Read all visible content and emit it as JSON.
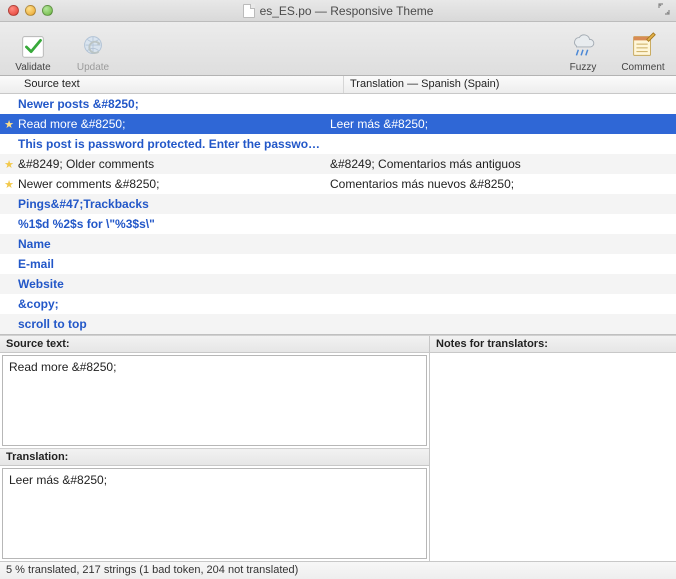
{
  "window": {
    "title": "es_ES.po — Responsive Theme"
  },
  "toolbar": {
    "validate": "Validate",
    "update": "Update",
    "fuzzy": "Fuzzy",
    "comment": "Comment"
  },
  "columns": {
    "source_text": "Source text",
    "translation": "Translation — Spanish (Spain)"
  },
  "rows": [
    {
      "star": "",
      "src": "Newer posts &#8250;",
      "tr": "",
      "style": "blue"
    },
    {
      "star": "★",
      "src": "Read more &#8250;",
      "tr": "Leer más &#8250;",
      "style": "sel"
    },
    {
      "star": "",
      "src": "This post is password protected. Enter the passwo…",
      "tr": "",
      "style": "blue"
    },
    {
      "star": "★",
      "src": "&#8249; Older comments",
      "tr": "&#8249; Comentarios más antiguos",
      "style": ""
    },
    {
      "star": "★",
      "src": "Newer comments &#8250;",
      "tr": "Comentarios más nuevos  &#8250;",
      "style": ""
    },
    {
      "star": "",
      "src": "Pings&#47;Trackbacks",
      "tr": "",
      "style": "blue"
    },
    {
      "star": "",
      "src": "%1$d %2$s for \\\"%3$s\\\"",
      "tr": "",
      "style": "blue"
    },
    {
      "star": "",
      "src": "Name",
      "tr": "",
      "style": "blue"
    },
    {
      "star": "",
      "src": "E-mail",
      "tr": "",
      "style": "blue"
    },
    {
      "star": "",
      "src": "Website",
      "tr": "",
      "style": "blue"
    },
    {
      "star": "",
      "src": "&copy;",
      "tr": "",
      "style": "blue"
    },
    {
      "star": "",
      "src": "scroll to top",
      "tr": "",
      "style": "blue"
    }
  ],
  "detail": {
    "source_label": "Source text:",
    "translation_label": "Translation:",
    "notes_label": "Notes for translators:",
    "source_value": "Read more &#8250;",
    "translation_value": "Leer más &#8250;"
  },
  "status": "5 % translated, 217 strings (1 bad token, 204 not translated)"
}
